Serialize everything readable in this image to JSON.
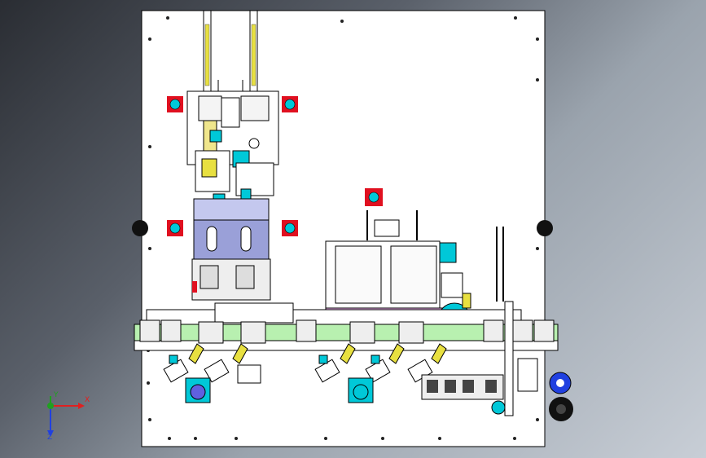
{
  "viewport": {
    "background_top": "#2a2d33",
    "background_bottom": "#c8ced6"
  },
  "model": {
    "plate_color": "#ffffff",
    "outline_color": "#000000",
    "accent_colors": {
      "cyan": "#00c8d8",
      "red": "#e01020",
      "yellow": "#e8e040",
      "lavender": "#9aa0d8",
      "green": "#b8f0b0",
      "pink": "#f0b0f0",
      "blue": "#2040e0"
    }
  },
  "axis_triad": {
    "x_label": "X",
    "y_label": "Y",
    "z_label": "Z",
    "x_color": "#e02020",
    "y_color": "#20a020",
    "z_color": "#2040e0"
  }
}
